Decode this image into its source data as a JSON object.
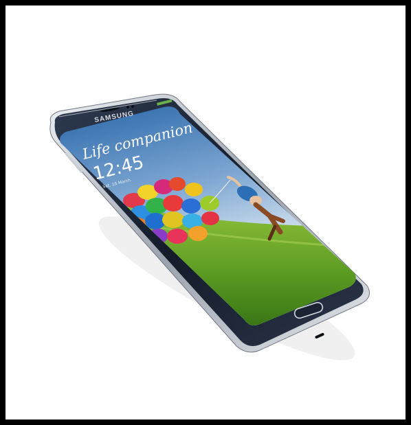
{
  "phone": {
    "brand": "SAMSUNG",
    "tagline": "Life companion",
    "clock": "12:45",
    "date": "Sat, 16 March"
  },
  "colors": {
    "frame": "#000000",
    "background": "#ffffff",
    "body": "#1b2536",
    "screen_sky": "#6b98c8",
    "screen_grass": "#4c8a22",
    "bezel": "#c7cbd1"
  }
}
